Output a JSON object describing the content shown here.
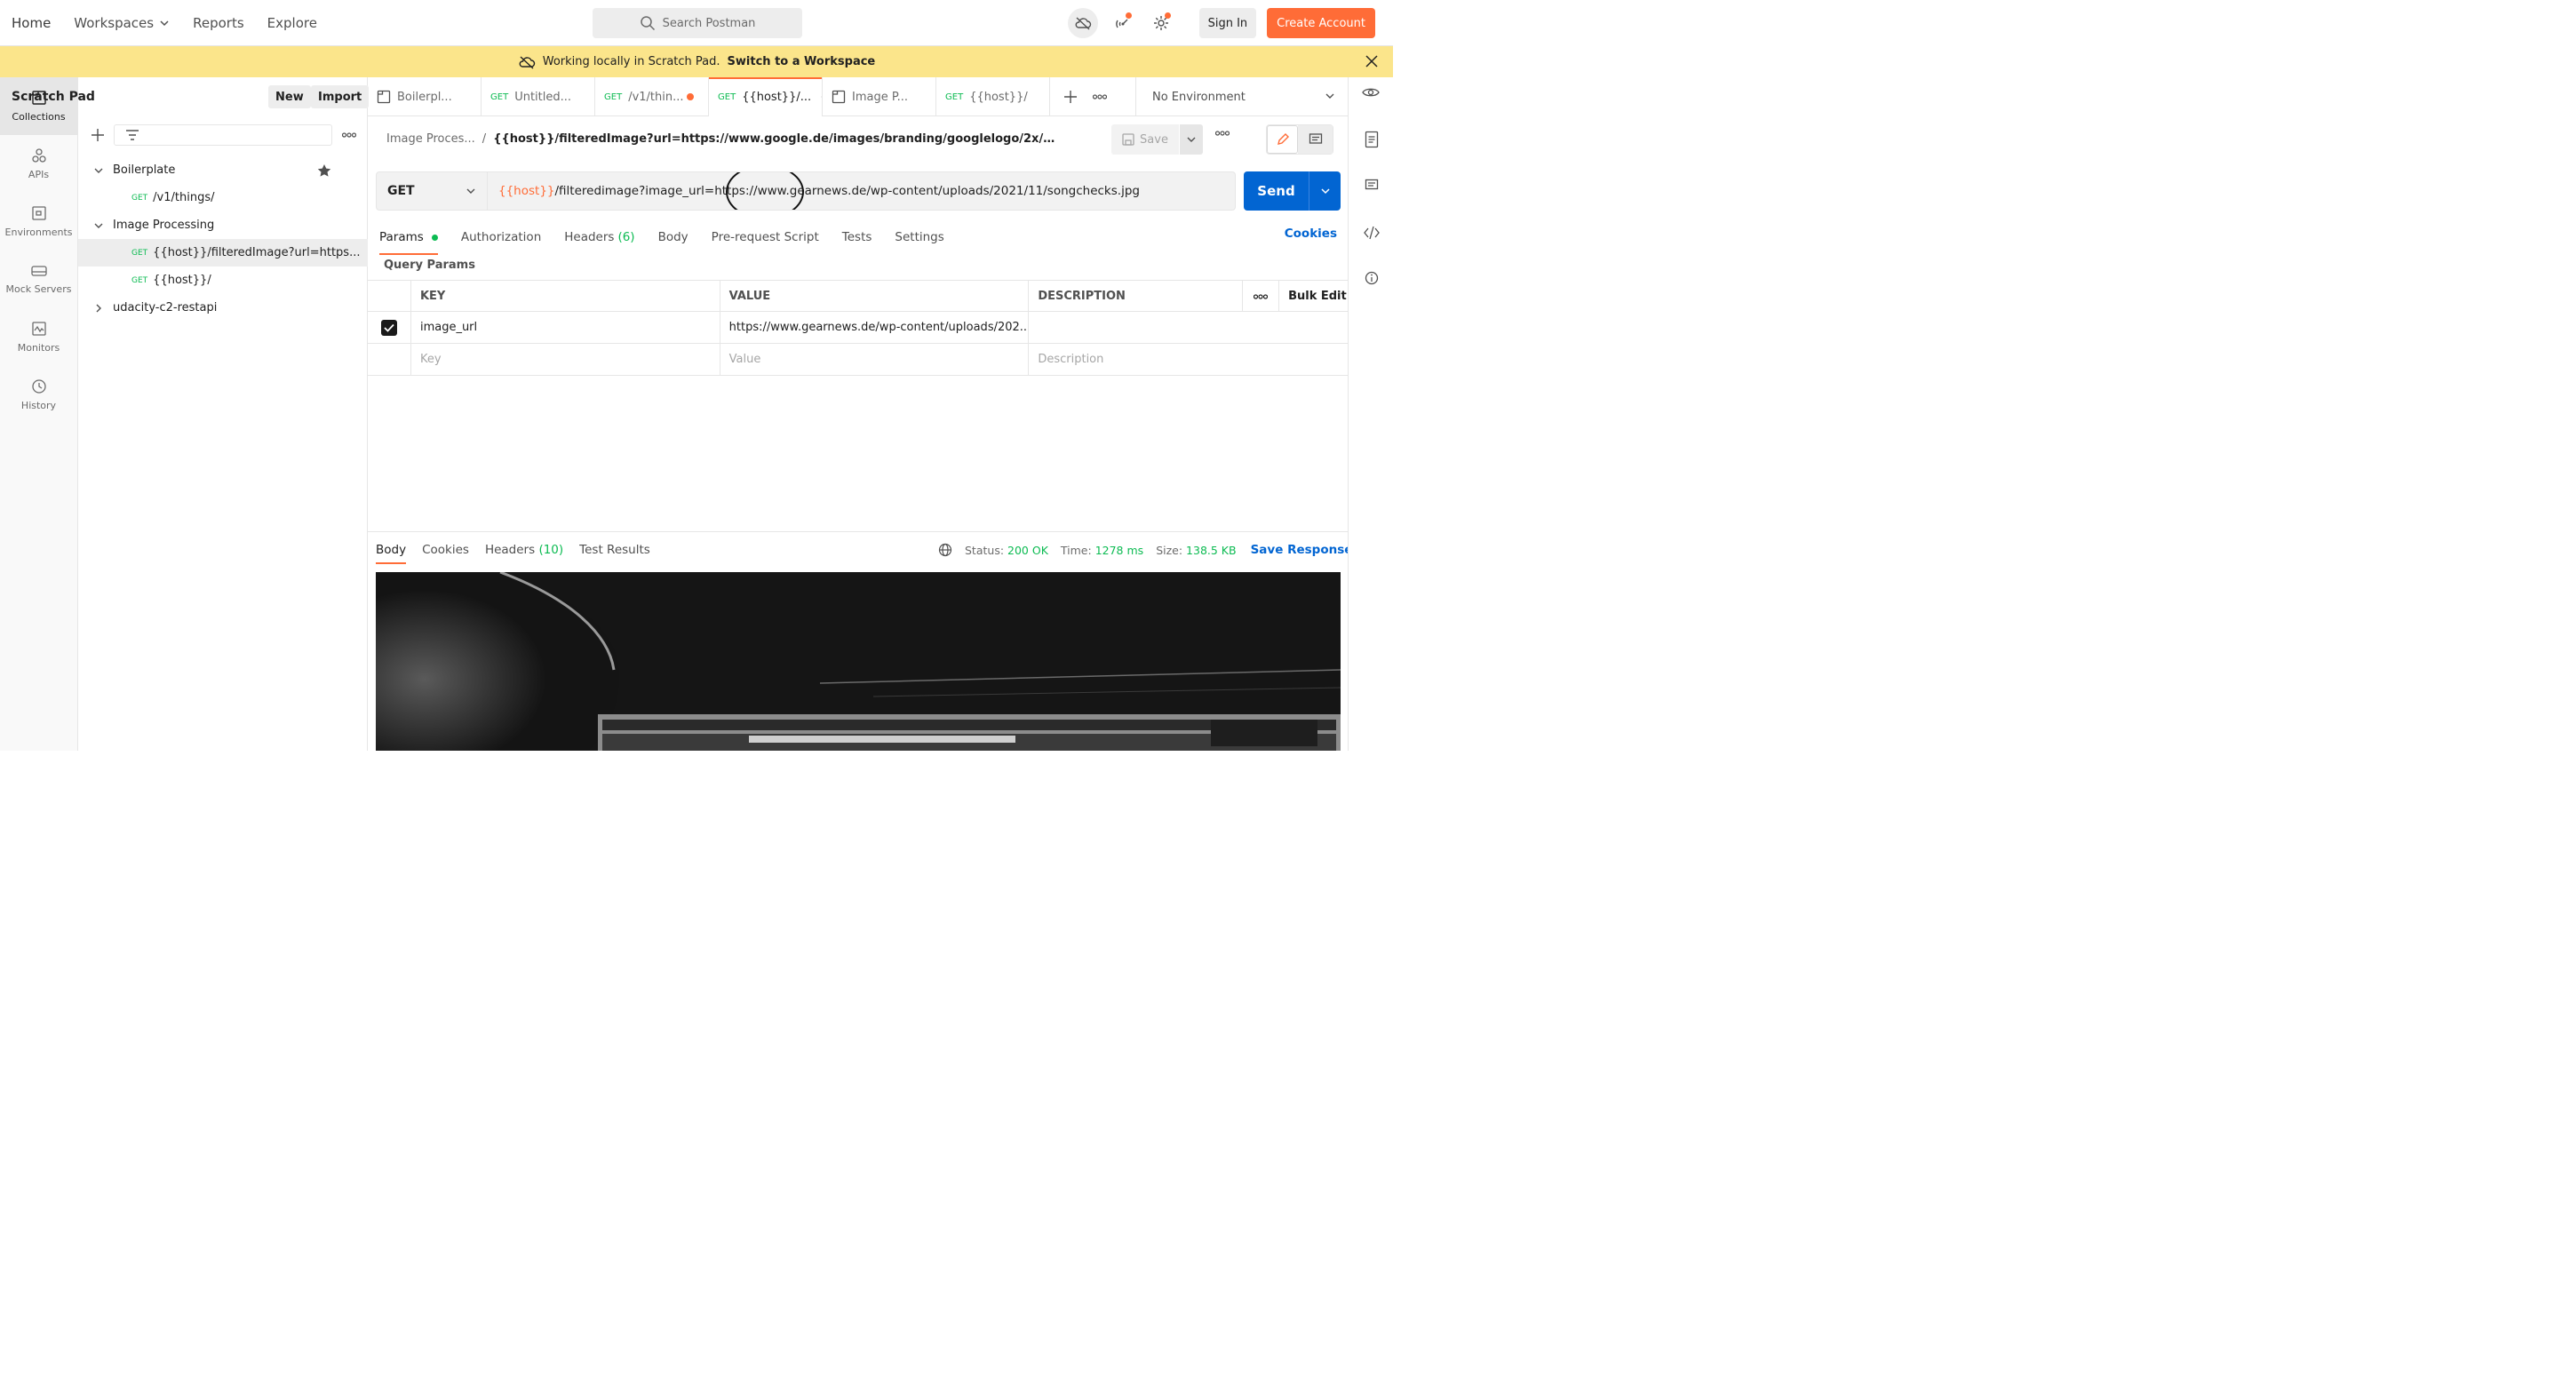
{
  "topnav": {
    "home": "Home",
    "workspaces": "Workspaces",
    "reports": "Reports",
    "explore": "Explore",
    "search_placeholder": "Search Postman",
    "sign_in": "Sign In",
    "create_account": "Create Account"
  },
  "banner": {
    "text": "Working locally in Scratch Pad.",
    "link": "Switch to a Workspace"
  },
  "rail": {
    "items": [
      {
        "label": "Collections",
        "icon": "collections-icon"
      },
      {
        "label": "APIs",
        "icon": "apis-icon"
      },
      {
        "label": "Environments",
        "icon": "environments-icon"
      },
      {
        "label": "Mock Servers",
        "icon": "mock-servers-icon"
      },
      {
        "label": "Monitors",
        "icon": "monitors-icon"
      },
      {
        "label": "History",
        "icon": "history-icon"
      }
    ]
  },
  "sidebar": {
    "title": "Scratch Pad",
    "new_label": "New",
    "import_label": "Import",
    "tree": [
      {
        "label": "Boilerplate"
      },
      {
        "method": "GET",
        "label": "/v1/things/"
      },
      {
        "label": "Image Processing"
      },
      {
        "method": "GET",
        "label": "{{host}}/filteredImage?url=https..."
      },
      {
        "method": "GET",
        "label": "{{host}}/"
      },
      {
        "label": "udacity-c2-restapi"
      }
    ]
  },
  "tabs": [
    {
      "label": "Boilerpl...",
      "icon": "collection-icon"
    },
    {
      "method": "GET",
      "label": "Untitled..."
    },
    {
      "method": "GET",
      "label": "/v1/thin..."
    },
    {
      "method": "GET",
      "label": "{{host}}/..."
    },
    {
      "label": "Image P...",
      "icon": "collection-icon"
    },
    {
      "method": "GET",
      "label": "{{host}}/"
    }
  ],
  "environment": "No Environment",
  "breadcrumb": {
    "parent": "Image Proces...",
    "separator": "/",
    "current": "{{host}}/filteredImage?url=https://www.google.de/images/branding/googlelogo/2x/googlelogo_co..."
  },
  "save_label": "Save",
  "request": {
    "method": "GET",
    "url_var": "{{host}}",
    "url_rest": "/filteredimage?image_url=https://www.gearnews.de/wp-content/uploads/2021/11/songchecks.jpg",
    "send": "Send"
  },
  "req_tabs": {
    "params": "Params",
    "authorization": "Authorization",
    "headers": "Headers",
    "headers_count": "(6)",
    "body": "Body",
    "prerequest": "Pre-request Script",
    "tests": "Tests",
    "settings": "Settings",
    "cookies": "Cookies"
  },
  "query_params": {
    "title": "Query Params",
    "headers": {
      "key": "KEY",
      "value": "VALUE",
      "description": "DESCRIPTION",
      "bulk_edit": "Bulk Edit"
    },
    "rows": [
      {
        "checked": true,
        "key": "image_url",
        "value": "https://www.gearnews.de/wp-content/uploads/202...",
        "description": ""
      }
    ],
    "placeholders": {
      "key": "Key",
      "value": "Value",
      "description": "Description"
    }
  },
  "response": {
    "tabs": {
      "body": "Body",
      "cookies": "Cookies",
      "headers": "Headers",
      "headers_count": "(10)",
      "test_results": "Test Results"
    },
    "status_label": "Status:",
    "status_value": "200 OK",
    "time_label": "Time:",
    "time_value": "1278 ms",
    "size_label": "Size:",
    "size_value": "138.5 KB",
    "save_response": "Save Response"
  },
  "colors": {
    "accent": "#ff6c37",
    "primary": "#0265d2",
    "banner": "#fbe58b",
    "success": "#0cbb52"
  }
}
